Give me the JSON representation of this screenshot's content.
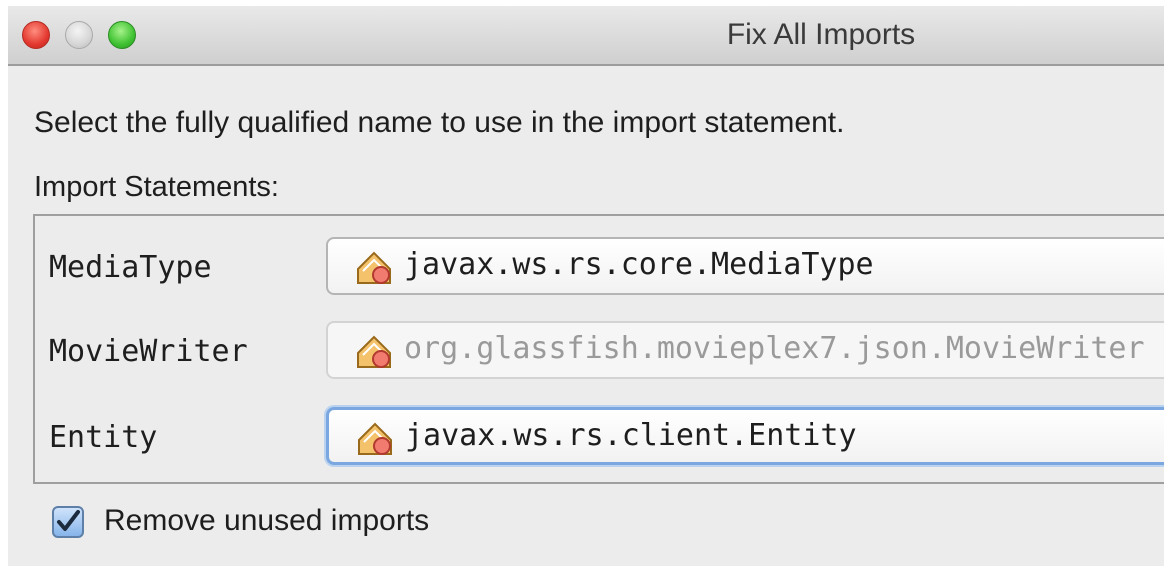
{
  "window": {
    "title": "Fix All Imports"
  },
  "instruction": "Select the fully qualified name to use in the import statement.",
  "section_label": "Import Statements:",
  "imports": [
    {
      "name": "MediaType",
      "selected": "javax.ws.rs.core.MediaType",
      "state": "normal"
    },
    {
      "name": "MovieWriter",
      "selected": "org.glassfish.movieplex7.json.MovieWriter",
      "state": "disabled"
    },
    {
      "name": "Entity",
      "selected": "javax.ws.rs.client.Entity",
      "state": "focused"
    }
  ],
  "remove_unused": {
    "label": "Remove unused imports",
    "checked": true
  },
  "icons": {
    "class_icon": "class-icon",
    "check_icon": "check-icon"
  },
  "colors": {
    "focus_ring": "#7aa7df",
    "checkbox_fill": "#86b4ea",
    "close": "#e3382f",
    "zoom": "#3fc232"
  }
}
